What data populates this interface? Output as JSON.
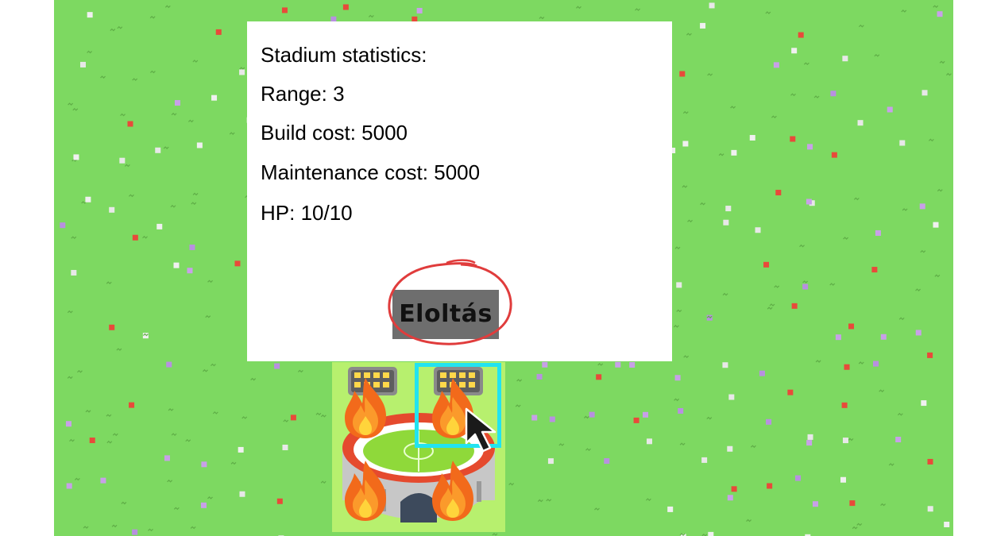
{
  "info_panel": {
    "title": "Stadium statistics:",
    "range_line": "Range: 3",
    "build_cost_line": "Build cost: 5000",
    "maintenance_line": "Maintenance cost: 5000",
    "hp_line": "HP: 10/10",
    "extinguish_button": "Eloltás"
  },
  "building": {
    "type": "stadium",
    "on_fire": true,
    "icon": "stadium-icon",
    "fire_icon": "fire-icon"
  },
  "colors": {
    "grass": "#7dd961",
    "selection": "#22e3f0",
    "button_bg": "#6e6e6e",
    "annotation": "#e03c3c"
  }
}
